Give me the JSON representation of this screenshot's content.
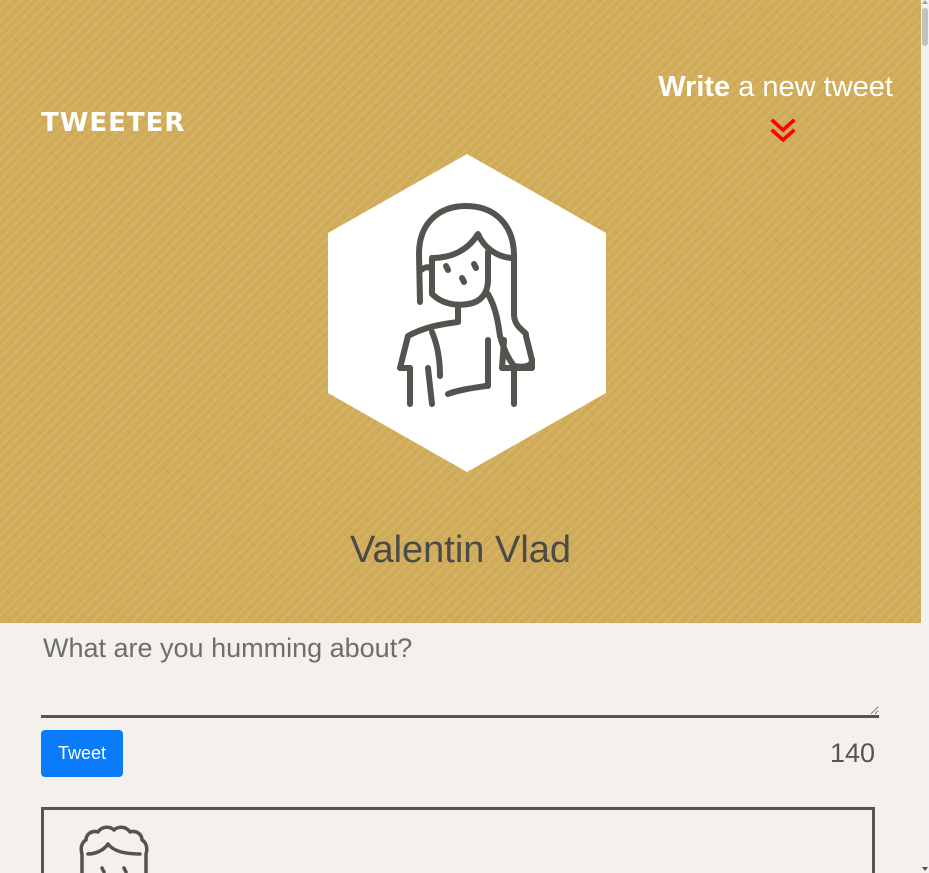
{
  "header": {
    "brand": "TWEETER",
    "compose_toggle": {
      "bold": "Write",
      "rest": "a new tweet"
    },
    "chevron_icon": "double-chevron-down-icon",
    "chevron_color": "#ff0000",
    "background_color": "#d0ab58"
  },
  "profile": {
    "avatar_icon": "woman-avatar-icon",
    "name": "Valentin Vlad"
  },
  "compose": {
    "placeholder": "What are you humming about?",
    "button_label": "Tweet",
    "button_color": "#0a7cf9",
    "char_count": "140"
  },
  "tweets": [
    {
      "avatar_icon": "man-curly-hair-avatar-icon"
    }
  ]
}
